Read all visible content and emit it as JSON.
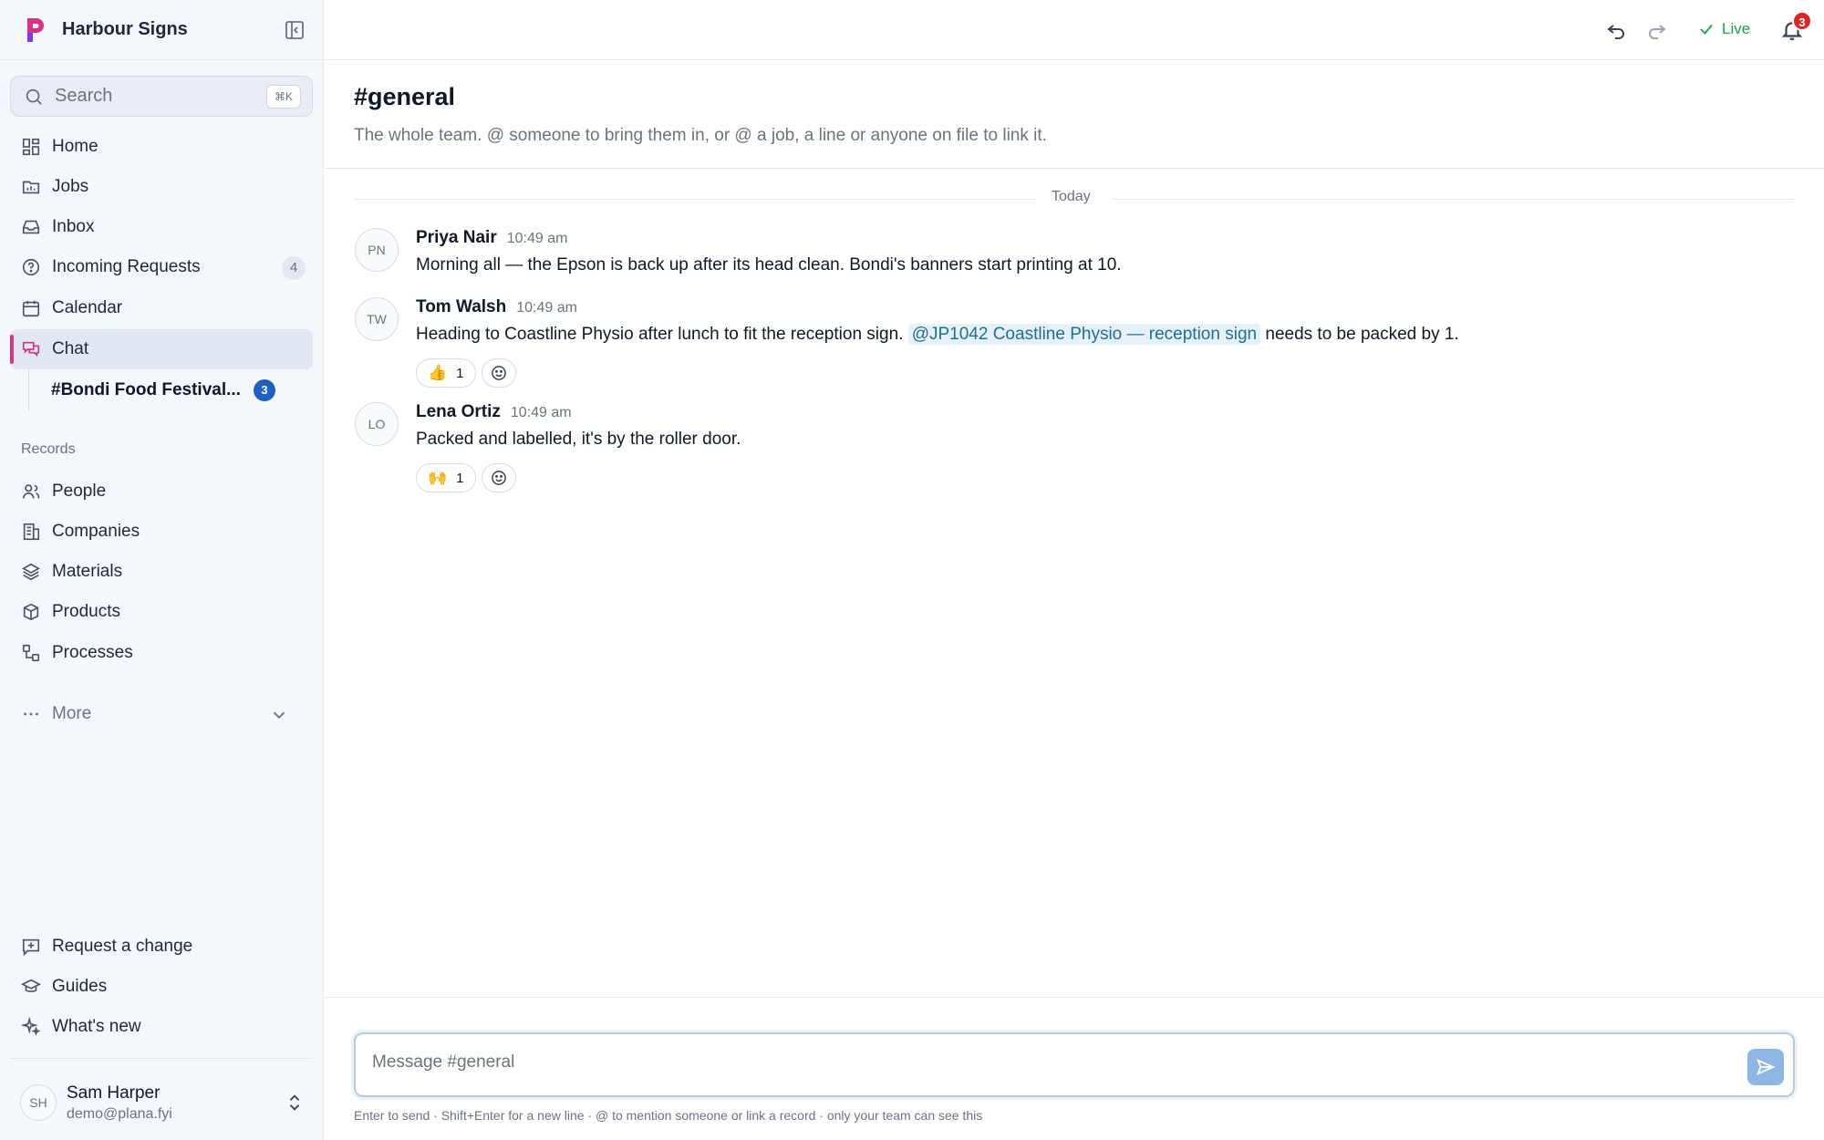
{
  "brand": {
    "name": "Harbour Signs"
  },
  "search": {
    "placeholder": "Search",
    "shortcut": "⌘K"
  },
  "nav": {
    "home": "Home",
    "jobs": "Jobs",
    "inbox": "Inbox",
    "incoming_requests": "Incoming Requests",
    "incoming_requests_count": "4",
    "calendar": "Calendar",
    "chat": "Chat",
    "chat_sub": {
      "label": "#Bondi Food Festival...",
      "badge": "3"
    }
  },
  "records": {
    "heading": "Records",
    "people": "People",
    "companies": "Companies",
    "materials": "Materials",
    "products": "Products",
    "processes": "Processes",
    "more": "More"
  },
  "footer": {
    "request_change": "Request a change",
    "guides": "Guides",
    "whats_new": "What's new"
  },
  "user": {
    "initials": "SH",
    "name": "Sam Harper",
    "email": "demo@plana.fyi"
  },
  "topbar": {
    "live_label": "Live",
    "notification_count": "3"
  },
  "channel": {
    "title": "#general",
    "description": "The whole team. @ someone to bring them in, or @ a job, a line or anyone on file to link it."
  },
  "day_divider": "Today",
  "messages": [
    {
      "initials": "PN",
      "name": "Priya Nair",
      "time": "10:49 am",
      "text": "Morning all — the Epson is back up after its head clean. Bondi's banners start printing at 10."
    },
    {
      "initials": "TW",
      "name": "Tom Walsh",
      "time": "10:49 am",
      "text_before": "Heading to Coastline Physio after lunch to fit the reception sign.",
      "mention": "@JP1042 Coastline Physio — reception sign",
      "text_after": "needs to be packed by 1.",
      "reaction": {
        "emoji": "👍",
        "count": "1"
      }
    },
    {
      "initials": "LO",
      "name": "Lena Ortiz",
      "time": "10:49 am",
      "text": "Packed and labelled, it's by the roller door.",
      "reaction": {
        "emoji": "🙌",
        "count": "1"
      }
    }
  ],
  "composer": {
    "placeholder": "Message #general",
    "hint": "Enter to send · Shift+Enter for a new line · @ to mention someone or link a record · only your team can see this"
  },
  "colors": {
    "accent_pink": "#d63384",
    "live_green": "#16a34a",
    "badge_blue": "#1f5fbf",
    "notification_red": "#dc2626",
    "mention_blue": "#1f6f95",
    "send_button": "#8fb7e6"
  },
  "icons": {
    "brand": "brand-p-logo",
    "collapse": "sidebar-collapse-icon",
    "search": "search-icon",
    "undo": "undo-icon",
    "redo": "redo-icon",
    "live": "check-icon",
    "notifications": "bell-icon",
    "send": "send-icon",
    "add_reaction": "smiley-plus-icon"
  }
}
